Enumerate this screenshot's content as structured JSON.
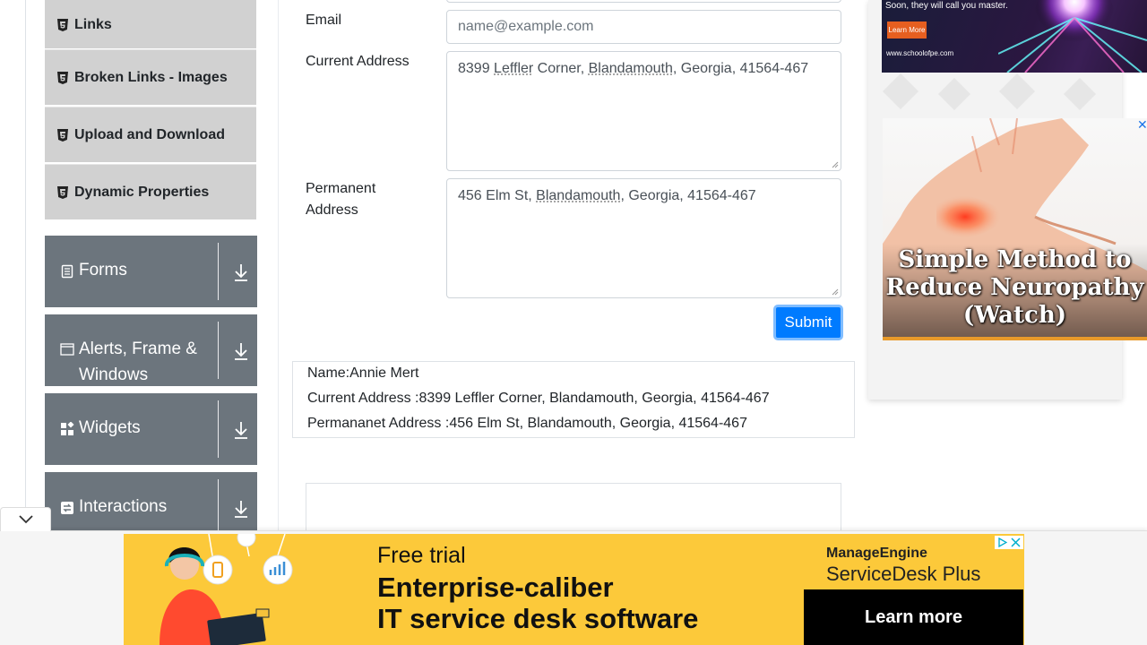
{
  "sidebar": {
    "elements_items": [
      {
        "label": "Links"
      },
      {
        "label": "Broken Links - Images"
      },
      {
        "label": "Upload and Download"
      },
      {
        "label": "Dynamic Properties"
      }
    ],
    "groups": [
      {
        "label": "Forms",
        "icon": "document-icon"
      },
      {
        "label": "Alerts, Frame & Windows",
        "icon": "window-icon"
      },
      {
        "label": "Widgets",
        "icon": "widgets-icon"
      },
      {
        "label": "Interactions",
        "icon": "interactions-icon"
      }
    ]
  },
  "form": {
    "email_label": "Email",
    "email_placeholder": "name@example.com",
    "current_address_label": "Current Address",
    "current_address_parts": [
      "8399 ",
      "Leffler",
      " Corner, ",
      "Blandamouth",
      ", Georgia, 41564-467"
    ],
    "permanent_address_label": "Permanent Address",
    "permanent_address_parts": [
      "456 Elm St, ",
      "Blandamouth",
      ", Georgia, 41564-467"
    ],
    "submit_label": "Submit"
  },
  "output": {
    "name": "Name:Annie Mert",
    "current_address": "Current Address :8399 Leffler Corner, Blandamouth, Georgia, 41564-467",
    "permanent_address": "Permananet Address :456 Elm St, Blandamouth, Georgia, 41564-467"
  },
  "ads": {
    "top": {
      "tagline": "Soon, they will call you master.",
      "button": "Learn More",
      "url": "www.schoolofpe.com"
    },
    "neuropathy": {
      "caption": "Simple Method to Reduce Neuropathy (Watch)",
      "close": "✕"
    },
    "bottom": {
      "kicker": "Free trial",
      "headline_1": "Enterprise-caliber",
      "headline_2": "IT service desk software",
      "brand_1": "ManageEngine",
      "brand_2": "ServiceDesk Plus",
      "cta": "Learn more"
    }
  },
  "colors": {
    "sidebar_group": "#6c757d",
    "sidebar_item": "#d1d1d1",
    "submit": "#007bff",
    "bottom_ad": "#fcc93a"
  }
}
